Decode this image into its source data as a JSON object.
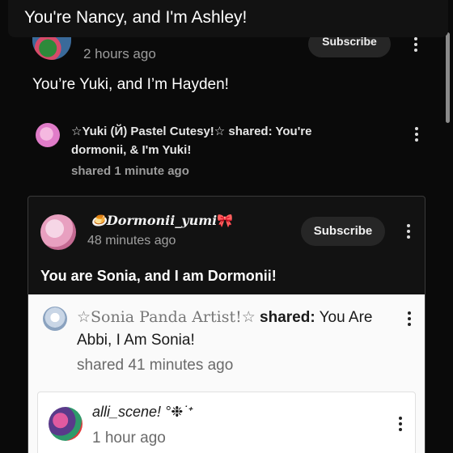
{
  "caption": "You're Nancy, and I'm Ashley!",
  "post": {
    "time": "2 hours ago",
    "subscribe_label": "Subscribe",
    "body": "You’re Yuki, and I’m Hayden!"
  },
  "share": {
    "line1": "☆Yuki (Й) Pastel Cutesy!☆ shared: You're",
    "line2": "dormonii, & I'm Yuki!",
    "meta": "shared 1 minute ago"
  },
  "card": {
    "username": "Dormonii_yumi",
    "username_prefix": "🍮",
    "username_suffix": "🎀",
    "time": "48 minutes ago",
    "subscribe_label": "Subscribe",
    "body": "You are Sonia, and I am Dormonii!"
  },
  "sonia_share": {
    "author": "☆Sonia Panda Artist!☆",
    "shared_word": "shared:",
    "text_part1": "You Are",
    "line2": "Abbi, I Am Sonia!",
    "meta": "shared 41 minutes ago"
  },
  "inner_post": {
    "username": "alli_scene! °❉˙ᐩ",
    "time": "1 hour ago"
  },
  "colors": {
    "background": "#0a0a0a",
    "card": "#121212",
    "subscribe_bg": "#262626",
    "panel": "#fafafa",
    "accent_pink": "#f47fa8"
  },
  "icons": {
    "more": "more-vertical-icon"
  }
}
